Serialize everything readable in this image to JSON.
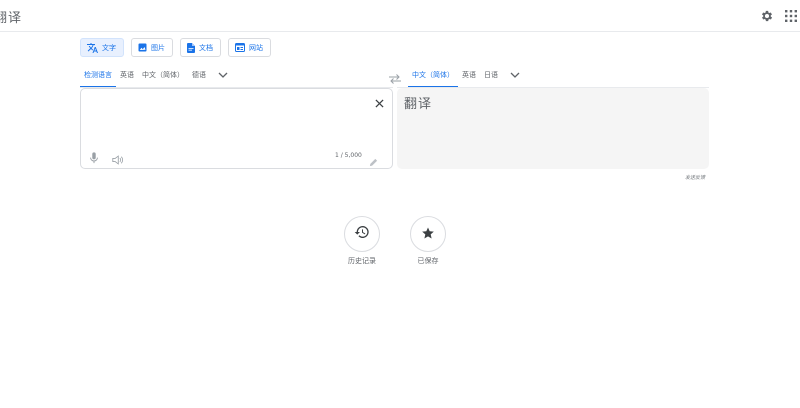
{
  "header": {
    "title": "翻译",
    "icons": [
      "settings-icon",
      "apps-icon"
    ]
  },
  "modes": [
    {
      "label": "文字",
      "icon": "translate-icon",
      "active": true
    },
    {
      "label": "图片",
      "icon": "image-icon",
      "active": false
    },
    {
      "label": "文档",
      "icon": "document-icon",
      "active": false
    },
    {
      "label": "网站",
      "icon": "website-icon",
      "active": false
    }
  ],
  "source_langs": [
    {
      "label": "检测语言",
      "active": true
    },
    {
      "label": "英语",
      "active": false
    },
    {
      "label": "中文（简体）",
      "active": false
    },
    {
      "label": "德语",
      "active": false
    }
  ],
  "target_langs": [
    {
      "label": "中文（简体）",
      "active": true
    },
    {
      "label": "英语",
      "active": false
    },
    {
      "label": "日语",
      "active": false
    }
  ],
  "source": {
    "value": "",
    "char_count": "1 / 5,000"
  },
  "target": {
    "text": "翻译"
  },
  "feedback_label": "发送反馈",
  "bottom": {
    "history_label": "历史记录",
    "saved_label": "已保存"
  },
  "colors": {
    "accent": "#1a73e8",
    "border": "#dadce0",
    "muted": "#5f6368",
    "target_bg": "#f5f5f5"
  }
}
